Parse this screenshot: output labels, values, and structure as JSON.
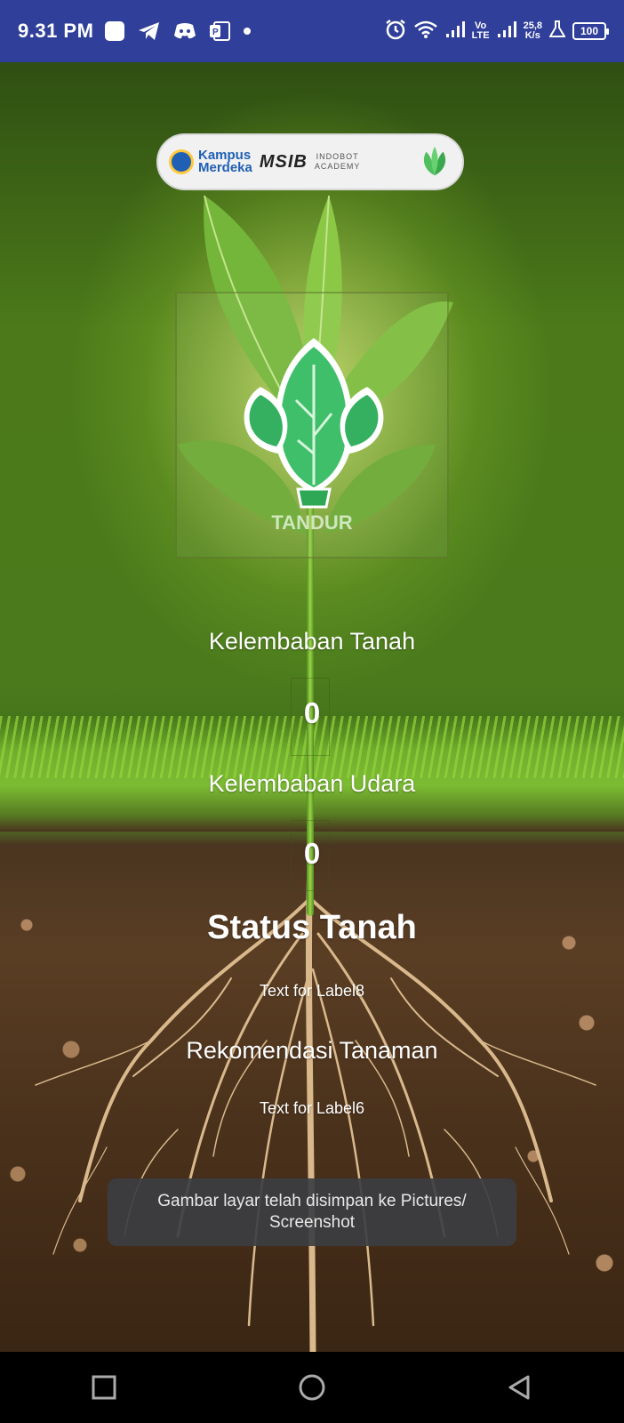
{
  "status_bar": {
    "time": "9.31 PM",
    "network_speed_value": "25,8",
    "network_speed_unit": "K/s",
    "volte": "Vo",
    "lte": "LTE",
    "battery": "100"
  },
  "banner": {
    "kampus_line1": "Kampus",
    "kampus_line2": "Merdeka",
    "msib": "MSIB",
    "indobot_line1": "INDOBOT",
    "indobot_line2": "ACADEMY"
  },
  "logo": {
    "label": "TANDUR"
  },
  "main": {
    "soil_moisture_label": "Kelembaban Tanah",
    "soil_moisture_value": "0",
    "air_humidity_label": "Kelembaban Udara",
    "air_humidity_value": "0",
    "soil_status_label": "Status Tanah",
    "soil_status_value": "Text for Label8",
    "plant_recommendation_label": "Rekomendasi Tanaman",
    "plant_recommendation_value": "Text for Label6"
  },
  "toast": {
    "message": "Gambar layar telah disimpan ke  Pictures/ Screenshot"
  },
  "colors": {
    "status_bar": "#2f3f9a",
    "logo_green": "#3fbf6a",
    "text": "#ffffff"
  },
  "icons": {
    "status_left": [
      "notification-square-icon",
      "telegram-icon",
      "discord-icon",
      "powerpoint-icon",
      "dot-icon"
    ],
    "status_right": [
      "alarm-icon",
      "wifi-icon",
      "signal-icon",
      "signal-icon",
      "lab-icon",
      "battery-icon"
    ],
    "nav": [
      "recents-square-icon",
      "home-circle-icon",
      "back-triangle-icon"
    ]
  }
}
